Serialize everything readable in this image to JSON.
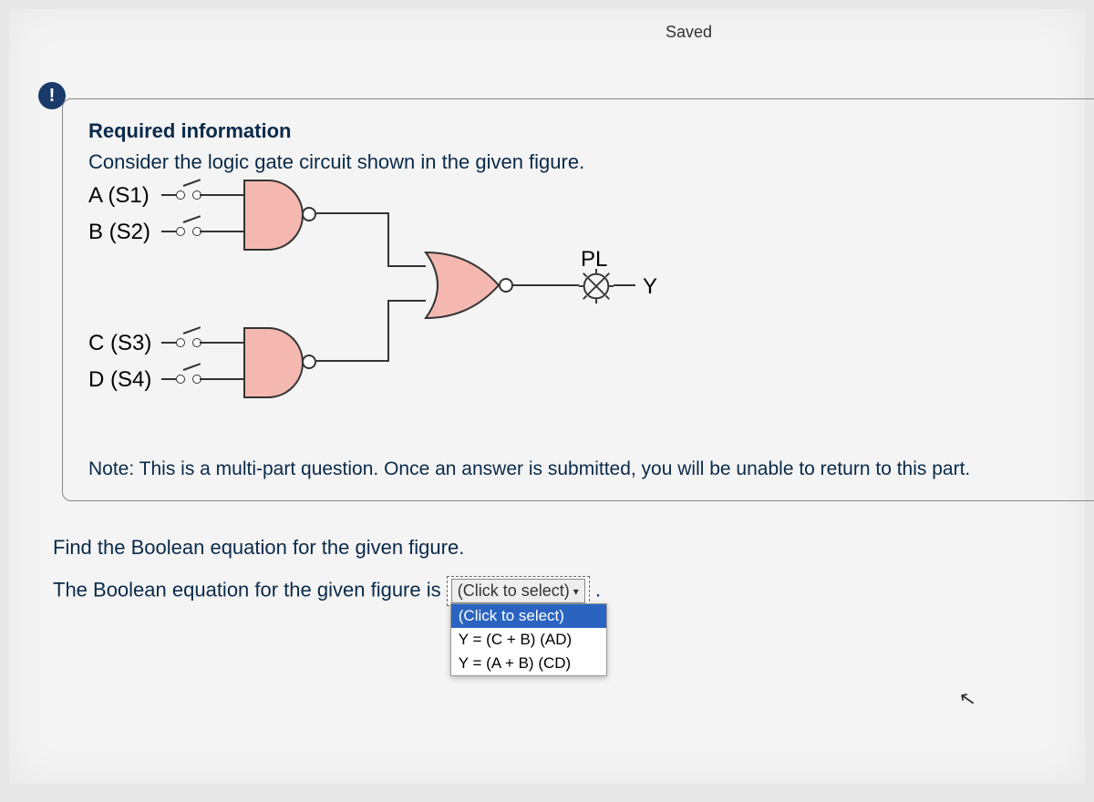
{
  "header": {
    "saved": "Saved"
  },
  "alert_glyph": "!",
  "info": {
    "required": "Required information",
    "consider": "Consider the logic gate circuit shown in the given figure.",
    "note": "Note: This is a multi-part question. Once an answer is submitted, you will be unable to return to this part."
  },
  "circuit": {
    "inputs": {
      "a": "A (S1)",
      "b": "B (S2)",
      "c": "C (S3)",
      "d": "D (S4)"
    },
    "pl": "PL",
    "y": "Y"
  },
  "question": {
    "prompt": "Find the Boolean equation for the given figure.",
    "stem": "The Boolean equation for the given figure is",
    "period": "."
  },
  "select": {
    "placeholder": "(Click to select)",
    "options": [
      "(Click to select)",
      "Y = (C + B) (AD)",
      "Y = (A + B) (CD)"
    ]
  }
}
